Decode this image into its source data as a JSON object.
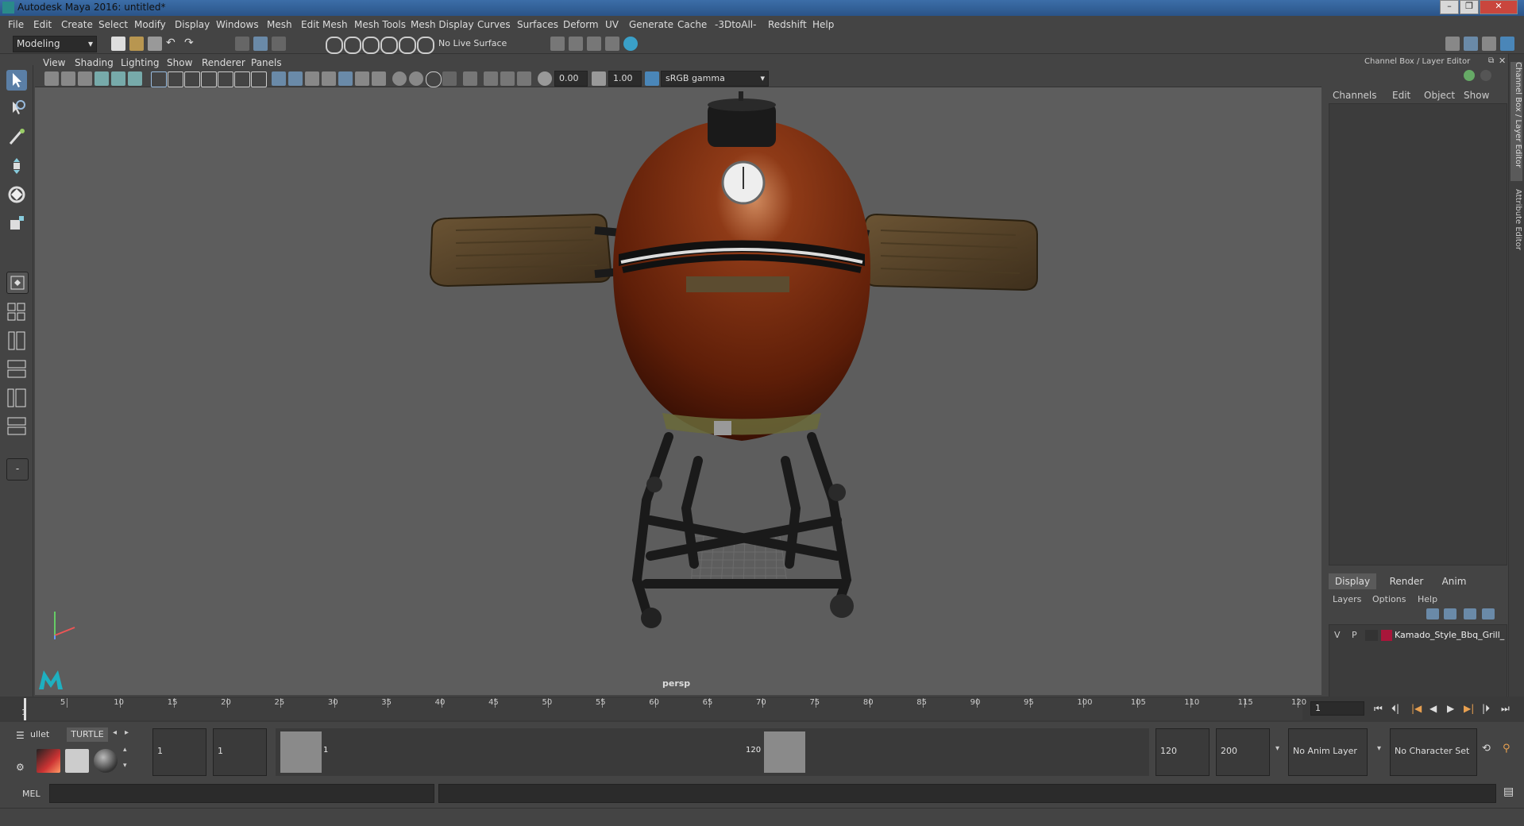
{
  "window": {
    "title": "Autodesk Maya 2016: untitled*"
  },
  "menu": [
    "File",
    "Edit",
    "Create",
    "Select",
    "Modify",
    "Display",
    "Windows",
    "Mesh",
    "Edit Mesh",
    "Mesh Tools",
    "Mesh Display",
    "Curves",
    "Surfaces",
    "Deform",
    "UV",
    "Generate",
    "Cache",
    "-3DtoAll-",
    "Redshift",
    "Help"
  ],
  "status": {
    "mode": "Modeling",
    "live_surface": "No Live Surface"
  },
  "viewport": {
    "menu": [
      "View",
      "Shading",
      "Lighting",
      "Show",
      "Renderer",
      "Panels"
    ],
    "exposure": "0.00",
    "gamma": "1.00",
    "color_space": "sRGB gamma",
    "camera_label": "persp"
  },
  "channel_box": {
    "header": "Channel Box / Layer Editor",
    "menu": [
      "Channels",
      "Edit",
      "Object",
      "Show"
    ]
  },
  "layer_editor": {
    "tabs": [
      "Display",
      "Render",
      "Anim"
    ],
    "menu": [
      "Layers",
      "Options",
      "Help"
    ],
    "layer": {
      "v": "V",
      "p": "P",
      "name": "Kamado_Style_Bbq_Grill_",
      "color": "#a8163a"
    }
  },
  "side_tabs": {
    "channel_box": "Channel Box / Layer Editor",
    "attribute_editor": "Attribute Editor"
  },
  "timeline": {
    "ticks": [
      "5",
      "10",
      "15",
      "20",
      "25",
      "30",
      "35",
      "40",
      "45",
      "50",
      "55",
      "60",
      "65",
      "70",
      "75",
      "80",
      "85",
      "90",
      "95",
      "100",
      "105",
      "110",
      "115",
      "120"
    ],
    "start_label": "1",
    "current_frame": "1"
  },
  "range": {
    "shelf_tabs": [
      "ullet",
      "TURTLE"
    ],
    "start_field": "1",
    "start2_field": "1",
    "range_start_label": "1",
    "range_end_label": "120",
    "end_field": "120",
    "end2_field": "200",
    "anim_layer": "No Anim Layer",
    "character_set": "No Character Set"
  },
  "command": {
    "label": "MEL"
  }
}
